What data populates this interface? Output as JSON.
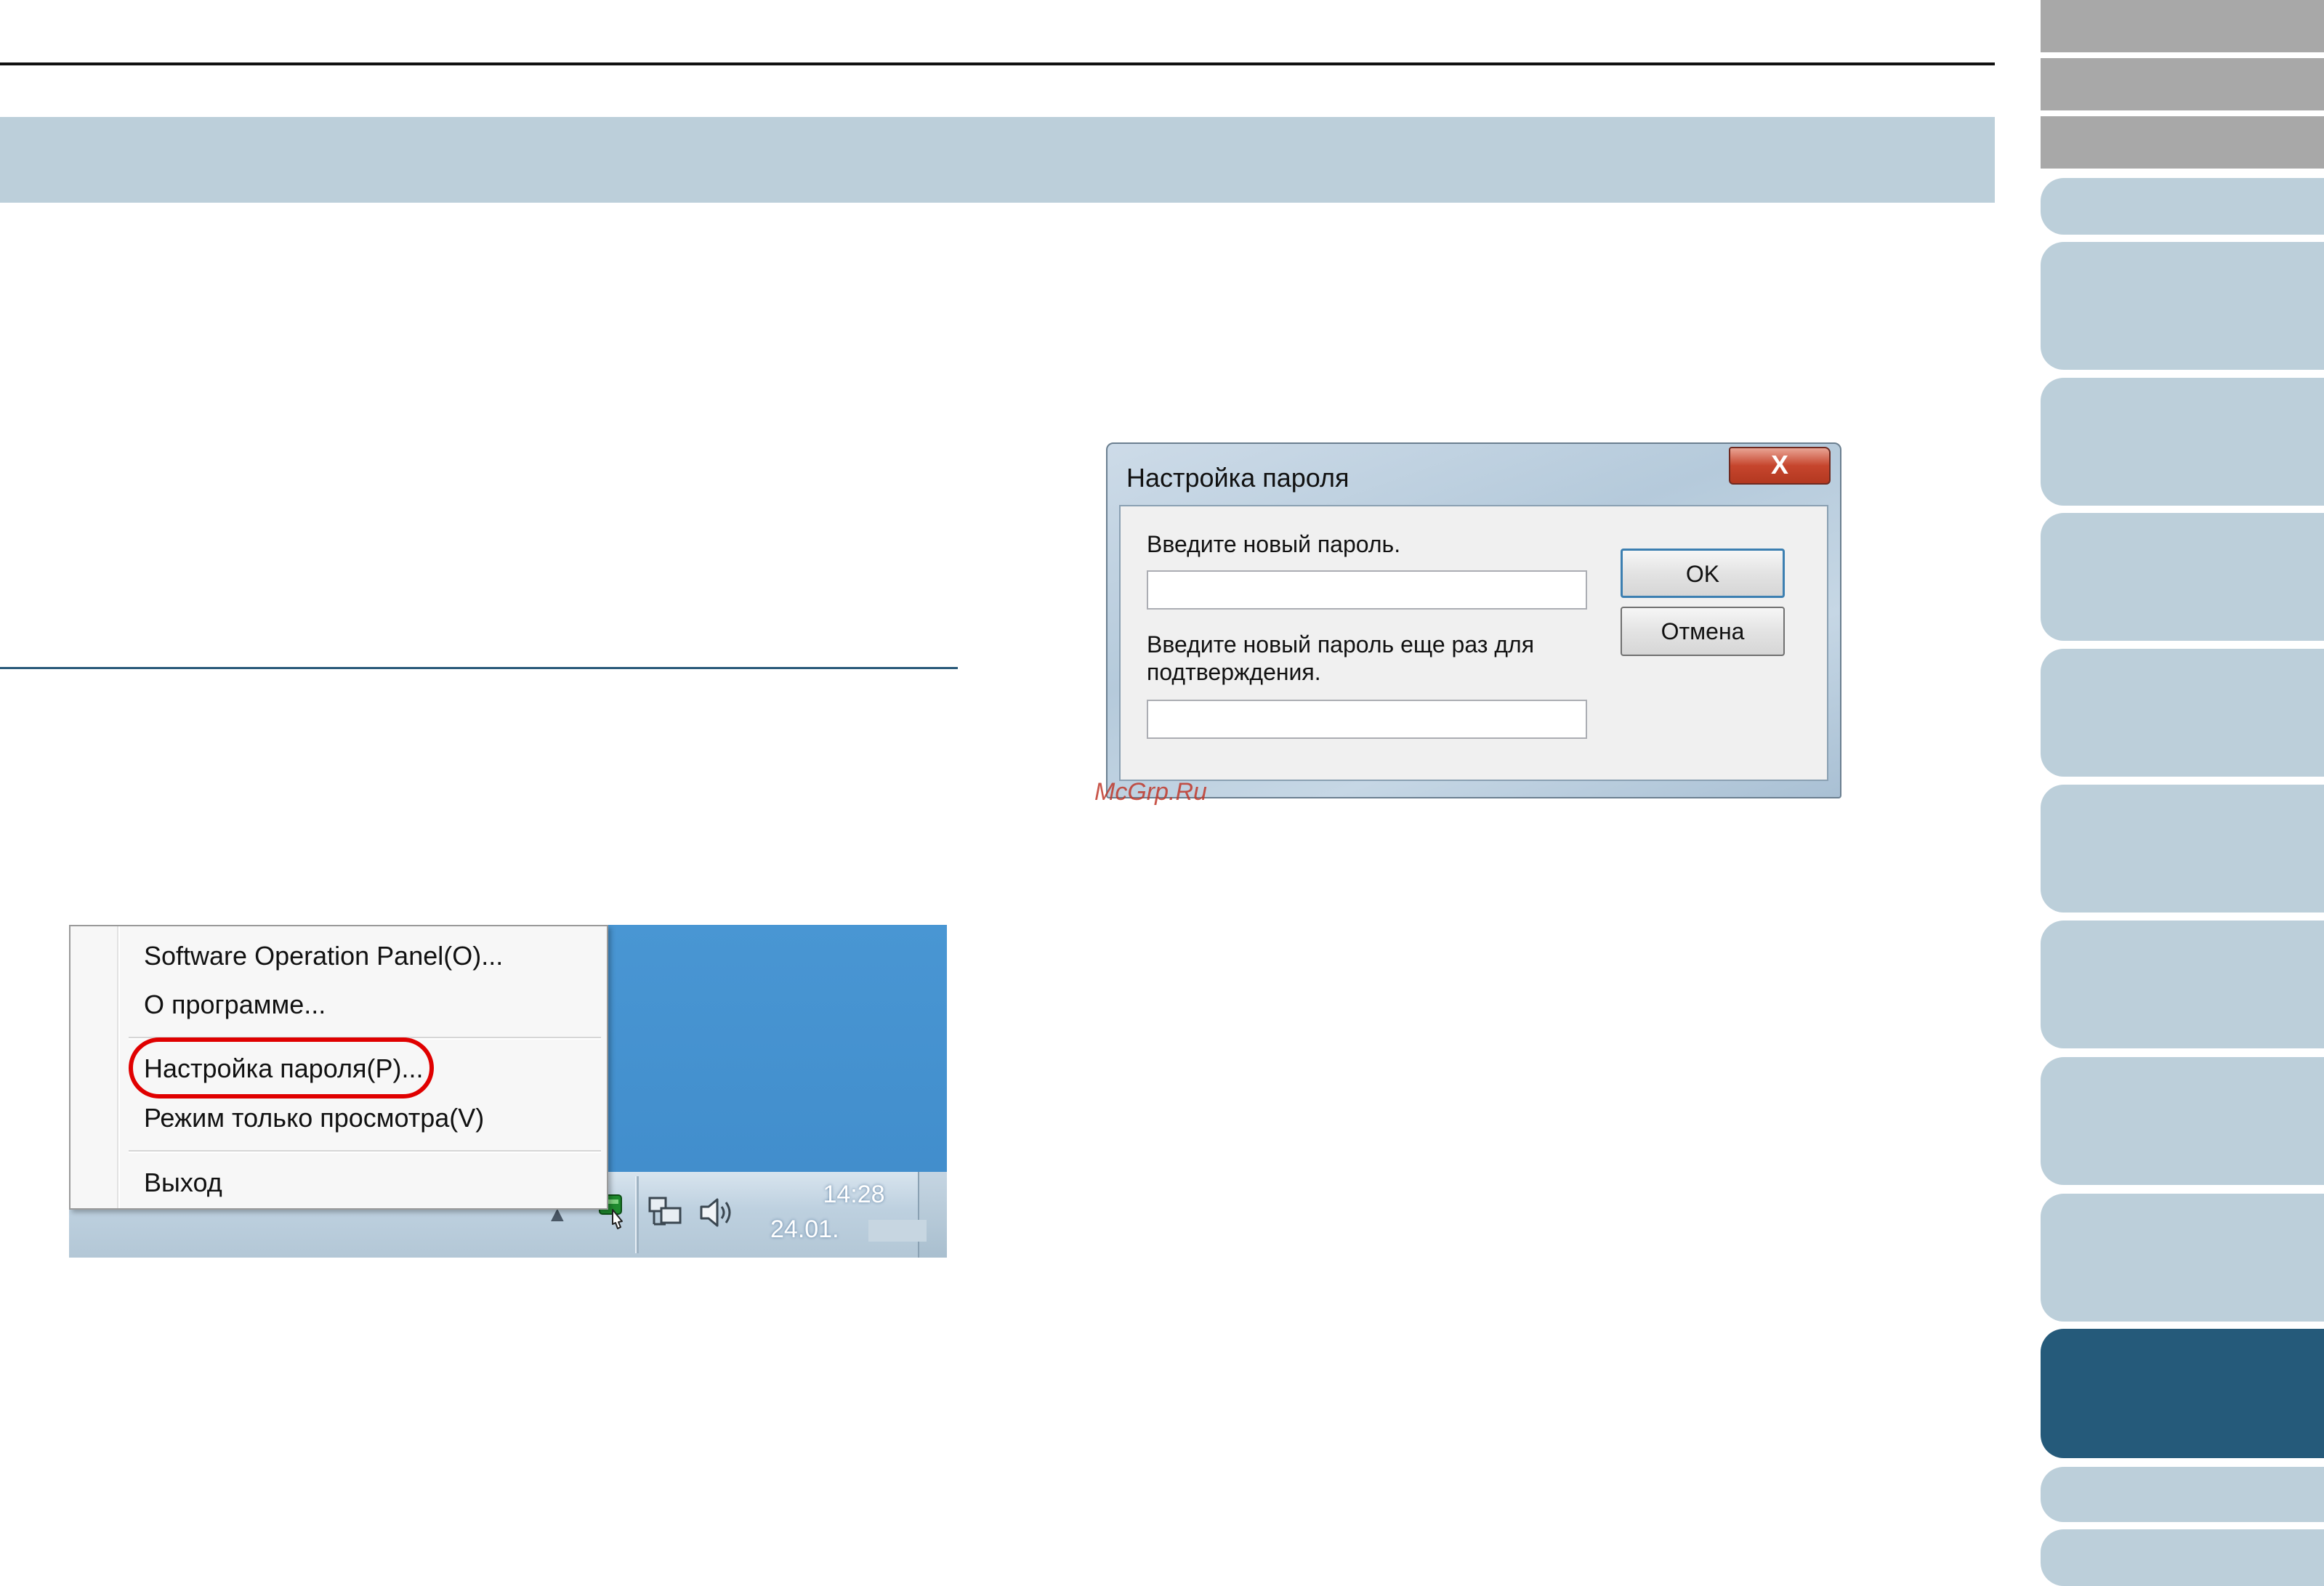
{
  "context_menu": {
    "items": [
      "Software Operation Panel(O)...",
      "О программе...",
      "Настройка пароля(P)...",
      "Режим только просмотра(V)",
      "Выход"
    ]
  },
  "taskbar": {
    "time": "14:28",
    "date": "24.01."
  },
  "dialog": {
    "title": "Настройка пароля",
    "close_label": "X",
    "new_password_label": "Введите новый пароль.",
    "new_password_value": "",
    "confirm_label_line1": "Введите новый пароль еще раз для",
    "confirm_label_line2": "подтверждения.",
    "confirm_value": "",
    "ok_label": "OK",
    "cancel_label": "Отмена"
  },
  "watermark": "McGrp.Ru",
  "colors": {
    "header_band": "#bccfda",
    "tab_gray": "#a8a8a8",
    "tab_blue": "#bccfda",
    "tab_active": "#255a7a",
    "highlight": "#e00000"
  },
  "side_tabs": {
    "count_gray": 3,
    "count_blue": 12,
    "active_index": 12
  }
}
